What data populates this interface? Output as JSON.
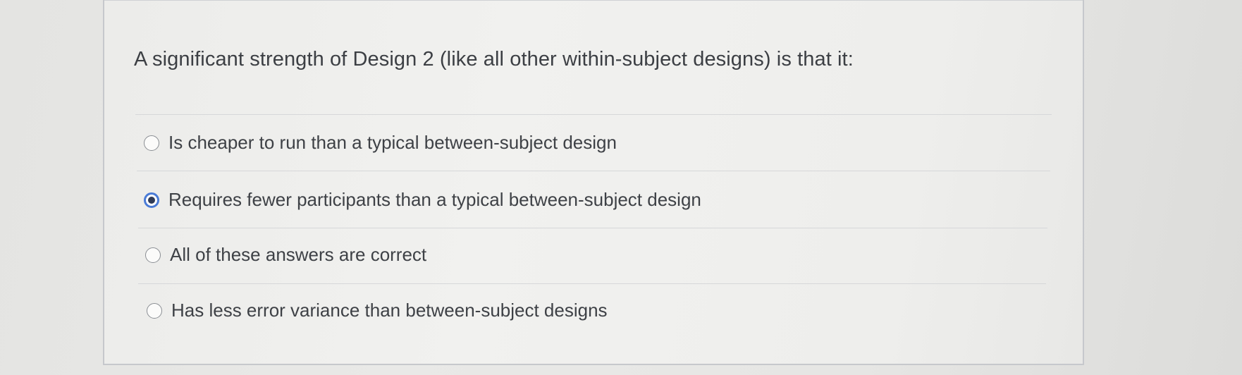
{
  "question": {
    "text": "A significant strength of Design 2 (like all other within-subject designs) is that it:"
  },
  "options": [
    {
      "label": "Is cheaper to run than a typical between-subject design",
      "selected": false
    },
    {
      "label": "Requires fewer participants than a typical between-subject design",
      "selected": true
    },
    {
      "label": "All of these answers are correct",
      "selected": false
    },
    {
      "label": "Has less error variance than between-subject designs",
      "selected": false
    }
  ],
  "colors": {
    "selected_radio": "#4a7bd6",
    "text": "#3e4146",
    "divider": "#d6d7d9"
  }
}
